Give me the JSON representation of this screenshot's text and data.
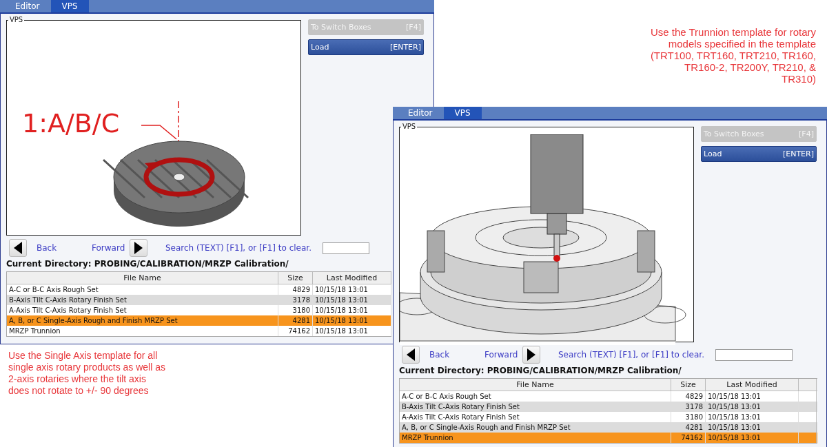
{
  "screens": [
    {
      "kind": "rotary",
      "tabs": [
        {
          "label": "Editor",
          "selected": false
        },
        {
          "label": "VPS",
          "selected": true
        }
      ],
      "viewport_label": "VPS",
      "callout": "1:A/B/C",
      "buttons": [
        {
          "label": "To Switch Boxes",
          "key": "[F4]",
          "disabled": true
        },
        {
          "label": "Load",
          "key": "[ENTER]",
          "disabled": false
        }
      ],
      "nav": {
        "back": "Back",
        "forward": "Forward",
        "search_hint": "Search (TEXT) [F1], or [F1] to clear."
      },
      "current_directory": "Current Directory: PROBING/CALIBRATION/MRZP Calibration/",
      "table": {
        "columns": [
          "File Name",
          "Size",
          "Last Modified"
        ],
        "rows": [
          {
            "name": "A-C or B-C Axis Rough Set",
            "size": "4829",
            "modified": "10/15/18 13:01",
            "selected": false
          },
          {
            "name": "B-Axis Tilt C-Axis Rotary Finish Set",
            "size": "3178",
            "modified": "10/15/18 13:01",
            "selected": false
          },
          {
            "name": "A-Axis Tilt C-Axis Rotary Finish Set",
            "size": "3180",
            "modified": "10/15/18 13:01",
            "selected": false
          },
          {
            "name": "A, B, or C Single-Axis Rough and Finish MRZP Set",
            "size": "4281",
            "modified": "10/15/18 13:01",
            "selected": true
          },
          {
            "name": "MRZP Trunnion",
            "size": "74162",
            "modified": "10/15/18 13:01",
            "selected": false
          }
        ]
      }
    },
    {
      "kind": "trunnion",
      "tabs": [
        {
          "label": "Editor",
          "selected": false
        },
        {
          "label": "VPS",
          "selected": true
        }
      ],
      "viewport_label": "VPS",
      "buttons": [
        {
          "label": "To Switch Boxes",
          "key": "[F4]",
          "disabled": true
        },
        {
          "label": "Load",
          "key": "[ENTER]",
          "disabled": false
        }
      ],
      "nav": {
        "back": "Back",
        "forward": "Forward",
        "search_hint": "Search (TEXT) [F1], or [F1] to clear."
      },
      "current_directory": "Current Directory: PROBING/CALIBRATION/MRZP Calibration/",
      "table": {
        "columns": [
          "File Name",
          "Size",
          "Last Modified"
        ],
        "rows": [
          {
            "name": "A-C or B-C Axis Rough Set",
            "size": "4829",
            "modified": "10/15/18 13:01",
            "selected": false
          },
          {
            "name": "B-Axis Tilt C-Axis Rotary Finish Set",
            "size": "3178",
            "modified": "10/15/18 13:01",
            "selected": false
          },
          {
            "name": "A-Axis Tilt C-Axis Rotary Finish Set",
            "size": "3180",
            "modified": "10/15/18 13:01",
            "selected": false
          },
          {
            "name": "A, B, or C Single-Axis Rough and Finish MRZP Set",
            "size": "4281",
            "modified": "10/15/18 13:01",
            "selected": false
          },
          {
            "name": "MRZP Trunnion",
            "size": "74162",
            "modified": "10/15/18 13:01",
            "selected": true
          }
        ]
      }
    }
  ],
  "notes": [
    {
      "text": "Use the Trunnion template for rotary models specified in the template (TRT100, TRT160, TRT210, TR160, TR160-2, TR200Y, TR210, & TR310)"
    },
    {
      "text": "Use the Single Axis template for all single axis rotary products as well as 2-axis rotaries where the tilt axis does not rotate to +/- 90 degrees"
    }
  ]
}
